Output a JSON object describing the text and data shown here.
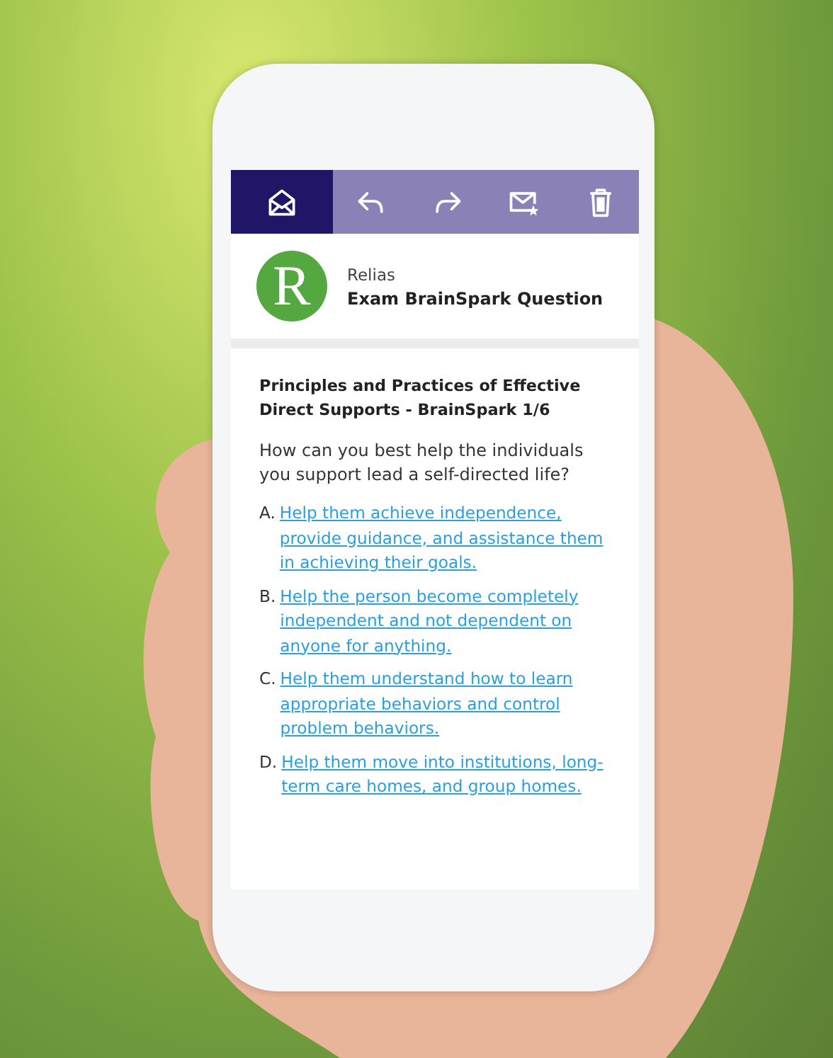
{
  "toolbar": {
    "buttons": [
      {
        "kind": "open-mail",
        "selected": true
      },
      {
        "kind": "reply",
        "selected": false
      },
      {
        "kind": "forward",
        "selected": false
      },
      {
        "kind": "starred-mail",
        "selected": false
      },
      {
        "kind": "trash",
        "selected": false
      }
    ]
  },
  "message": {
    "logo": "R",
    "sender": "Relias",
    "subject": "Exam BrainSpark Question"
  },
  "body": {
    "title": "Principles and Practices of Effective Direct Supports - BrainSpark 1/6",
    "question": "How can you best help the individuals you support lead a self-directed life?",
    "options": [
      {
        "letter": "A.",
        "text": "Help them achieve independence, provide guidance, and assistance them in achieving their goals."
      },
      {
        "letter": "B.",
        "text": "Help the person become completely independent and not dependent on anyone for anything."
      },
      {
        "letter": "C.",
        "text": "Help them understand how to learn appropriate behaviors and control problem behaviors."
      },
      {
        "letter": "D.",
        "text": "Help them move into institutions, long-term care homes, and group homes."
      }
    ]
  }
}
